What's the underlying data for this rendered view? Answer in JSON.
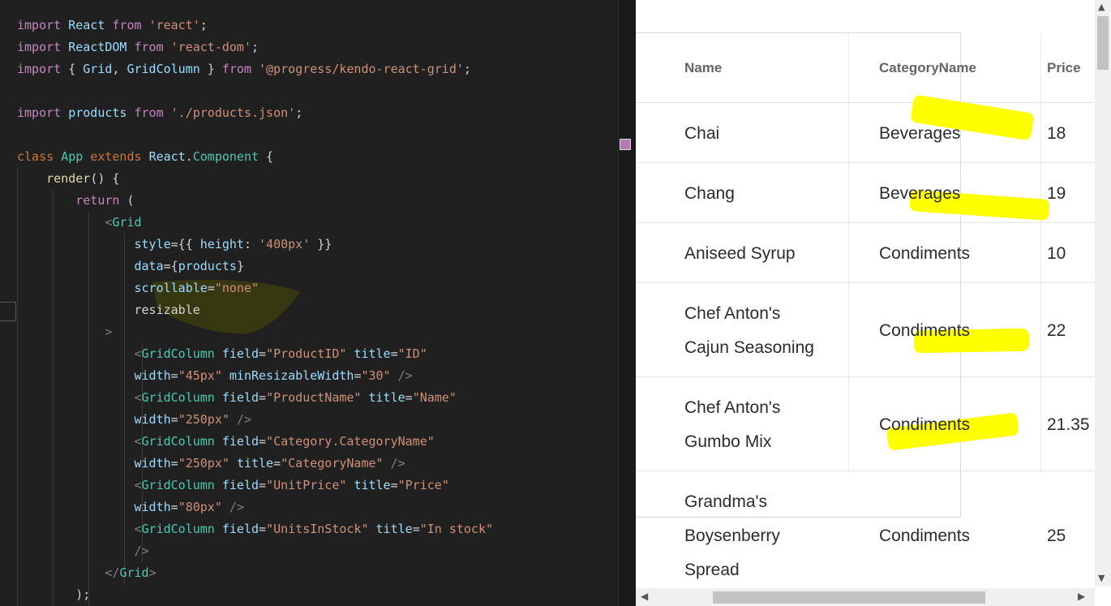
{
  "editor": {
    "lines": [
      [
        [
          "import",
          "kw"
        ],
        [
          " ",
          "pun"
        ],
        [
          "React",
          "var"
        ],
        [
          " ",
          "pun"
        ],
        [
          "from",
          "kw"
        ],
        [
          " ",
          "pun"
        ],
        [
          "'react'",
          "str"
        ],
        [
          ";",
          "pun"
        ]
      ],
      [
        [
          "import",
          "kw"
        ],
        [
          " ",
          "pun"
        ],
        [
          "ReactDOM",
          "var"
        ],
        [
          " ",
          "pun"
        ],
        [
          "from",
          "kw"
        ],
        [
          " ",
          "pun"
        ],
        [
          "'react-dom'",
          "str"
        ],
        [
          ";",
          "pun"
        ]
      ],
      [
        [
          "import",
          "kw"
        ],
        [
          " { ",
          "pun"
        ],
        [
          "Grid",
          "var"
        ],
        [
          ", ",
          "pun"
        ],
        [
          "GridColumn",
          "var"
        ],
        [
          " } ",
          "pun"
        ],
        [
          "from",
          "kw"
        ],
        [
          " ",
          "pun"
        ],
        [
          "'@progress/kendo-react-grid'",
          "str"
        ],
        [
          ";",
          "pun"
        ]
      ],
      [],
      [
        [
          "import",
          "kw"
        ],
        [
          " ",
          "pun"
        ],
        [
          "products",
          "var"
        ],
        [
          " ",
          "pun"
        ],
        [
          "from",
          "kw"
        ],
        [
          " ",
          "pun"
        ],
        [
          "'./products.json'",
          "str"
        ],
        [
          ";",
          "pun"
        ]
      ],
      [],
      [
        [
          "class",
          "kw2"
        ],
        [
          " ",
          "pun"
        ],
        [
          "App",
          "cls"
        ],
        [
          " ",
          "pun"
        ],
        [
          "extends",
          "kw2"
        ],
        [
          " ",
          "pun"
        ],
        [
          "React",
          "var"
        ],
        [
          ".",
          "pun"
        ],
        [
          "Component",
          "cls"
        ],
        [
          " {",
          "pun"
        ]
      ],
      [
        [
          "    ",
          "pun"
        ],
        [
          "render",
          "fn"
        ],
        [
          "() {",
          "pun"
        ]
      ],
      [
        [
          "        ",
          "pun"
        ],
        [
          "return",
          "kw"
        ],
        [
          " (",
          "pun"
        ]
      ],
      [
        [
          "            ",
          "pun"
        ],
        [
          "<",
          "ang"
        ],
        [
          "Grid",
          "tag"
        ]
      ],
      [
        [
          "                ",
          "pun"
        ],
        [
          "style",
          "attr"
        ],
        [
          "={{ ",
          "pun"
        ],
        [
          "height",
          "attr"
        ],
        [
          ": ",
          "pun"
        ],
        [
          "'400px'",
          "str"
        ],
        [
          " }}",
          "pun"
        ]
      ],
      [
        [
          "                ",
          "pun"
        ],
        [
          "data",
          "attr"
        ],
        [
          "={",
          "pun"
        ],
        [
          "products",
          "var"
        ],
        [
          "}",
          "pun"
        ]
      ],
      [
        [
          "                ",
          "pun"
        ],
        [
          "scrollable",
          "attr"
        ],
        [
          "=",
          "pun"
        ],
        [
          "\"none\"",
          "str"
        ]
      ],
      [
        [
          "                ",
          "pun"
        ],
        [
          "resizable",
          "sel"
        ]
      ],
      [
        [
          "            ",
          "pun"
        ],
        [
          ">",
          "ang"
        ]
      ],
      [
        [
          "                ",
          "pun"
        ],
        [
          "<",
          "ang"
        ],
        [
          "GridColumn",
          "tag"
        ],
        [
          " ",
          "pun"
        ],
        [
          "field",
          "attr"
        ],
        [
          "=",
          "pun"
        ],
        [
          "\"ProductID\"",
          "str"
        ],
        [
          " ",
          "pun"
        ],
        [
          "title",
          "attr"
        ],
        [
          "=",
          "pun"
        ],
        [
          "\"ID\"",
          "str"
        ]
      ],
      [
        [
          "                ",
          "pun"
        ],
        [
          "width",
          "attr"
        ],
        [
          "=",
          "pun"
        ],
        [
          "\"45px\"",
          "str"
        ],
        [
          " ",
          "pun"
        ],
        [
          "minResizableWidth",
          "attr"
        ],
        [
          "=",
          "pun"
        ],
        [
          "\"30\"",
          "str"
        ],
        [
          " ",
          "pun"
        ],
        [
          "/>",
          "ang"
        ]
      ],
      [
        [
          "                ",
          "pun"
        ],
        [
          "<",
          "ang"
        ],
        [
          "GridColumn",
          "tag"
        ],
        [
          " ",
          "pun"
        ],
        [
          "field",
          "attr"
        ],
        [
          "=",
          "pun"
        ],
        [
          "\"ProductName\"",
          "str"
        ],
        [
          " ",
          "pun"
        ],
        [
          "title",
          "attr"
        ],
        [
          "=",
          "pun"
        ],
        [
          "\"Name\"",
          "str"
        ]
      ],
      [
        [
          "                ",
          "pun"
        ],
        [
          "width",
          "attr"
        ],
        [
          "=",
          "pun"
        ],
        [
          "\"250px\"",
          "str"
        ],
        [
          " ",
          "pun"
        ],
        [
          "/>",
          "ang"
        ]
      ],
      [
        [
          "                ",
          "pun"
        ],
        [
          "<",
          "ang"
        ],
        [
          "GridColumn",
          "tag"
        ],
        [
          " ",
          "pun"
        ],
        [
          "field",
          "attr"
        ],
        [
          "=",
          "pun"
        ],
        [
          "\"Category.CategoryName\"",
          "str"
        ]
      ],
      [
        [
          "                ",
          "pun"
        ],
        [
          "width",
          "attr"
        ],
        [
          "=",
          "pun"
        ],
        [
          "\"250px\"",
          "str"
        ],
        [
          " ",
          "pun"
        ],
        [
          "title",
          "attr"
        ],
        [
          "=",
          "pun"
        ],
        [
          "\"CategoryName\"",
          "str"
        ],
        [
          " ",
          "pun"
        ],
        [
          "/>",
          "ang"
        ]
      ],
      [
        [
          "                ",
          "pun"
        ],
        [
          "<",
          "ang"
        ],
        [
          "GridColumn",
          "tag"
        ],
        [
          " ",
          "pun"
        ],
        [
          "field",
          "attr"
        ],
        [
          "=",
          "pun"
        ],
        [
          "\"UnitPrice\"",
          "str"
        ],
        [
          " ",
          "pun"
        ],
        [
          "title",
          "attr"
        ],
        [
          "=",
          "pun"
        ],
        [
          "\"Price\"",
          "str"
        ]
      ],
      [
        [
          "                ",
          "pun"
        ],
        [
          "width",
          "attr"
        ],
        [
          "=",
          "pun"
        ],
        [
          "\"80px\"",
          "str"
        ],
        [
          " ",
          "pun"
        ],
        [
          "/>",
          "ang"
        ]
      ],
      [
        [
          "                ",
          "pun"
        ],
        [
          "<",
          "ang"
        ],
        [
          "GridColumn",
          "tag"
        ],
        [
          " ",
          "pun"
        ],
        [
          "field",
          "attr"
        ],
        [
          "=",
          "pun"
        ],
        [
          "\"UnitsInStock\"",
          "str"
        ],
        [
          " ",
          "pun"
        ],
        [
          "title",
          "attr"
        ],
        [
          "=",
          "pun"
        ],
        [
          "\"In stock\"",
          "str"
        ]
      ],
      [
        [
          "                ",
          "pun"
        ],
        [
          "/>",
          "ang"
        ]
      ],
      [
        [
          "            ",
          "pun"
        ],
        [
          "</",
          "ang"
        ],
        [
          "Grid",
          "tag"
        ],
        [
          ">",
          "ang"
        ]
      ],
      [
        [
          "        ",
          "pun"
        ],
        [
          ");",
          "pun"
        ]
      ]
    ]
  },
  "grid": {
    "headers": {
      "name": "Name",
      "category": "CategoryName",
      "price": "Price"
    },
    "rows": [
      {
        "name": [
          "Chai"
        ],
        "category": "Beverages",
        "price": "18"
      },
      {
        "name": [
          "Chang"
        ],
        "category": "Beverages",
        "price": "19"
      },
      {
        "name": [
          "Aniseed Syrup"
        ],
        "category": "Condiments",
        "price": "10"
      },
      {
        "name": [
          "Chef Anton's",
          "Cajun Seasoning"
        ],
        "category": "Condiments",
        "price": "22"
      },
      {
        "name": [
          "Chef Anton's",
          "Gumbo Mix"
        ],
        "category": "Condiments",
        "price": "21.35"
      },
      {
        "name": [
          "Grandma's",
          "Boysenberry",
          "Spread"
        ],
        "category": "Condiments",
        "price": "25"
      }
    ]
  },
  "colors": {
    "editor_bg": "#202020",
    "highlight": "#ffff00",
    "code_scribble": "#3a3a10"
  },
  "icons": {
    "scroll_up": "▲",
    "scroll_down": "▼",
    "scroll_left": "◀",
    "scroll_right": "▶"
  }
}
